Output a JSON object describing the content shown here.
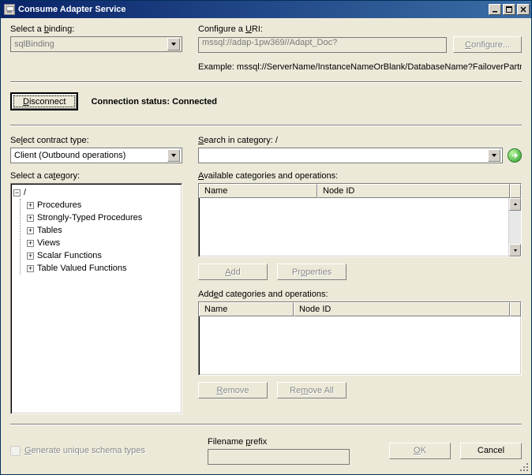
{
  "window": {
    "title": "Consume Adapter Service"
  },
  "binding": {
    "label": "Select a binding:",
    "value": "sqlBinding"
  },
  "uri": {
    "label": "Configure a URI:",
    "value": "mssql://adap-1pw369//Adapt_Doc?",
    "configure_label": "Configure...",
    "example": "Example: mssql://ServerName/InstanceNameOrBlank/DatabaseName?FailoverPartner=pa"
  },
  "connect": {
    "disconnect_label": "Disconnect",
    "status_label": "Connection status:",
    "status_value": "Connected"
  },
  "contract": {
    "label": "Select contract type:",
    "value": "Client (Outbound operations)"
  },
  "search": {
    "label": "Search in category: /",
    "value": ""
  },
  "category": {
    "label": "Select a category:",
    "root": "/",
    "items": [
      "Procedures",
      "Strongly-Typed Procedures",
      "Tables",
      "Views",
      "Scalar Functions",
      "Table Valued Functions"
    ]
  },
  "available": {
    "label": "Available categories and operations:",
    "col_name": "Name",
    "col_node": "Node ID",
    "add_label": "Add",
    "props_label": "Properties"
  },
  "added": {
    "label": "Added categories and operations:",
    "col_name": "Name",
    "col_node": "Node ID",
    "remove_label": "Remove",
    "removeall_label": "Remove All"
  },
  "footer": {
    "gen_label": "Generate unique schema types",
    "filename_label": "Filename prefix",
    "filename_value": "",
    "ok_label": "OK",
    "cancel_label": "Cancel"
  }
}
